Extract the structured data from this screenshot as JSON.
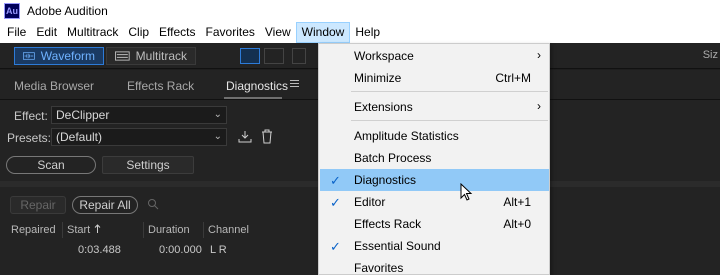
{
  "titlebar": {
    "app_icon": "Au",
    "title": "Adobe Audition"
  },
  "menubar": [
    "File",
    "Edit",
    "Multitrack",
    "Clip",
    "Effects",
    "Favorites",
    "View",
    "Window",
    "Help"
  ],
  "toolbar": {
    "waveform": "Waveform",
    "multitrack": "Multitrack",
    "right_label": "Siz"
  },
  "panel": {
    "tabs": {
      "media_browser": "Media Browser",
      "effects_rack": "Effects Rack",
      "diagnostics": "Diagnostics"
    },
    "effect_label": "Effect:",
    "effect_value": "DeClipper",
    "presets_label": "Presets:",
    "presets_value": "(Default)",
    "scan": "Scan",
    "settings": "Settings",
    "repair": "Repair",
    "repair_all": "Repair All",
    "columns": {
      "repaired": "Repaired",
      "start": "Start",
      "duration": "Duration",
      "channel": "Channel"
    },
    "row": {
      "start": "0:03.488",
      "duration": "0:00.000",
      "channel": "L R"
    }
  },
  "dropdown": {
    "workspace": "Workspace",
    "minimize": "Minimize",
    "minimize_shortcut": "Ctrl+M",
    "extensions": "Extensions",
    "amplitude_statistics": "Amplitude Statistics",
    "batch_process": "Batch Process",
    "diagnostics": "Diagnostics",
    "editor": "Editor",
    "editor_shortcut": "Alt+1",
    "effects_rack": "Effects Rack",
    "effects_rack_shortcut": "Alt+0",
    "essential_sound": "Essential Sound",
    "favorites": "Favorites"
  },
  "colors": {
    "accent": "#2d7bd8",
    "menu_hover": "#91c9f7",
    "check": "#0a63c9"
  },
  "icons": [
    "app-icon",
    "waveform-icon",
    "multitrack-icon",
    "save-preset-icon",
    "delete-preset-icon",
    "search-icon",
    "check-icon",
    "submenu-arrow-icon",
    "mouse-cursor-icon"
  ]
}
